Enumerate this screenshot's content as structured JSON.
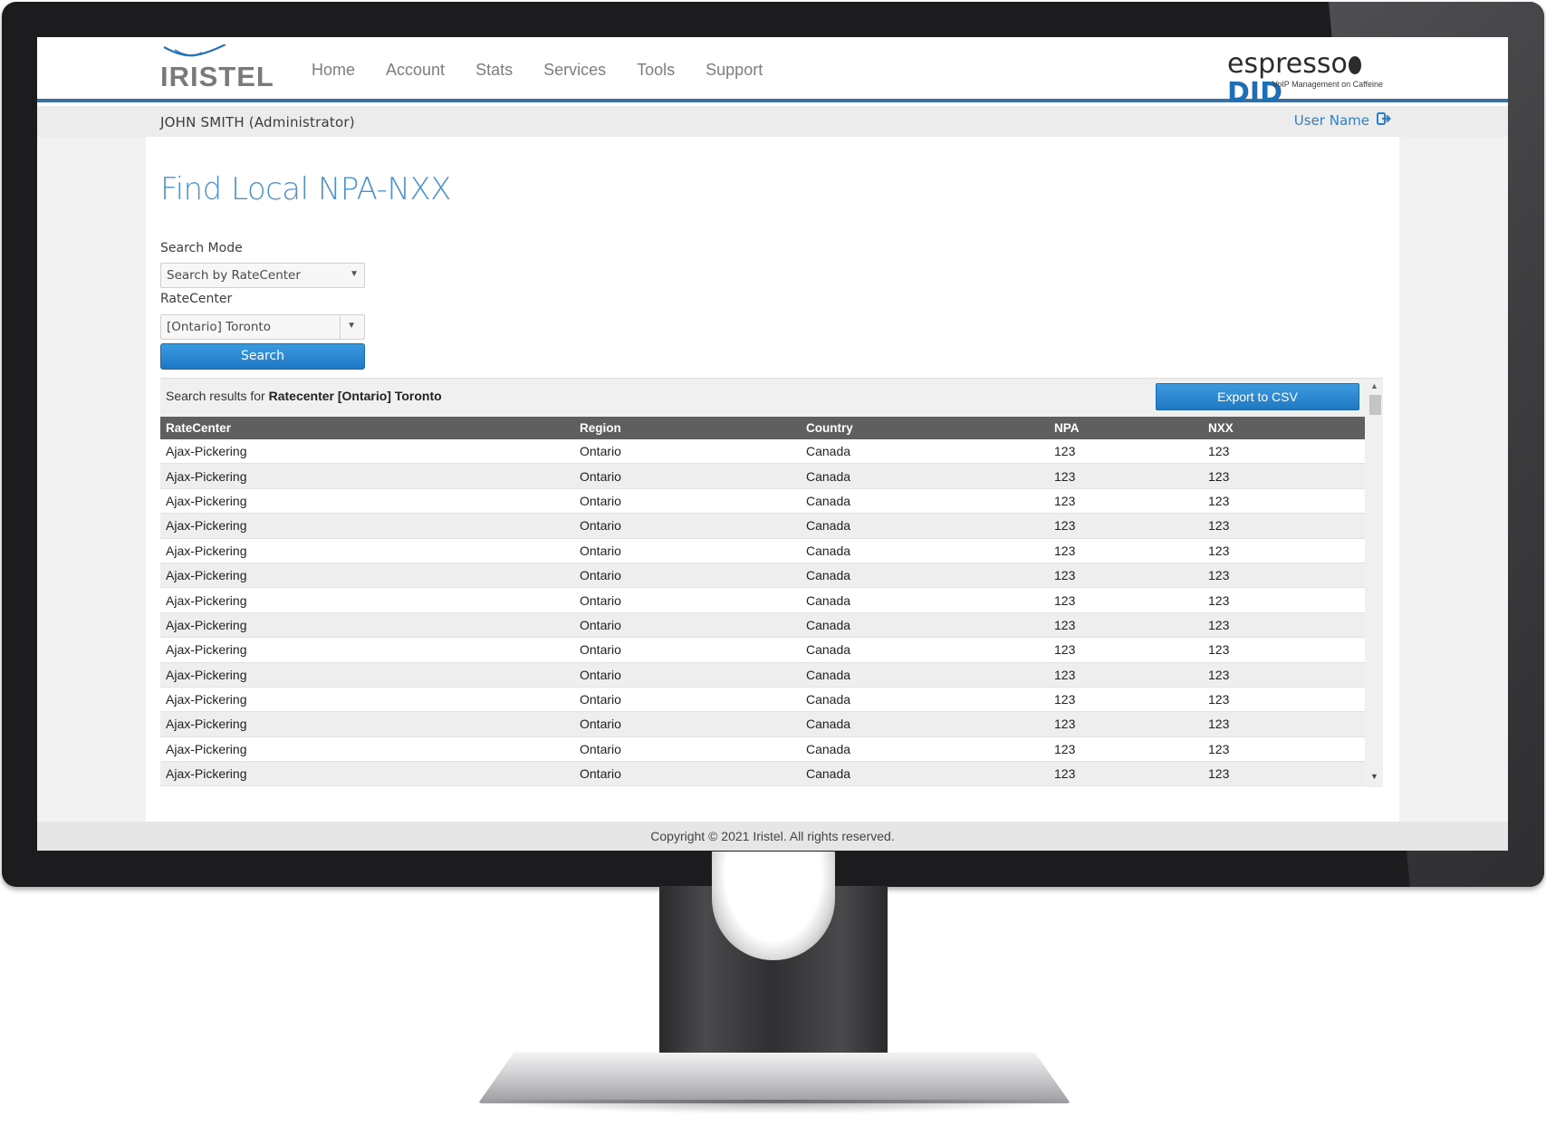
{
  "header": {
    "brand_left": "IRISTEL",
    "brand_right_prefix": "espresso",
    "brand_right_suffix": "DID",
    "brand_right_tagline": "VoIP Management on Caffeine",
    "nav": [
      "Home",
      "Account",
      "Stats",
      "Services",
      "Tools",
      "Support"
    ]
  },
  "userbar": {
    "current_user": "JOHN SMITH (Administrator)",
    "user_link": "User Name"
  },
  "page": {
    "title": "Find Local NPA-NXX",
    "search_mode_label": "Search Mode",
    "search_mode_value": "Search by RateCenter",
    "ratecenter_label": "RateCenter",
    "ratecenter_value": "[Ontario] Toronto",
    "search_button": "Search"
  },
  "results": {
    "caption_prefix": "Search results for",
    "caption_query": "Ratecenter [Ontario] Toronto",
    "export_button": "Export to CSV",
    "columns": [
      "RateCenter",
      "Region",
      "Country",
      "NPA",
      "NXX"
    ],
    "rows": [
      [
        "Ajax-Pickering",
        "Ontario",
        "Canada",
        "123",
        "123"
      ],
      [
        "Ajax-Pickering",
        "Ontario",
        "Canada",
        "123",
        "123"
      ],
      [
        "Ajax-Pickering",
        "Ontario",
        "Canada",
        "123",
        "123"
      ],
      [
        "Ajax-Pickering",
        "Ontario",
        "Canada",
        "123",
        "123"
      ],
      [
        "Ajax-Pickering",
        "Ontario",
        "Canada",
        "123",
        "123"
      ],
      [
        "Ajax-Pickering",
        "Ontario",
        "Canada",
        "123",
        "123"
      ],
      [
        "Ajax-Pickering",
        "Ontario",
        "Canada",
        "123",
        "123"
      ],
      [
        "Ajax-Pickering",
        "Ontario",
        "Canada",
        "123",
        "123"
      ],
      [
        "Ajax-Pickering",
        "Ontario",
        "Canada",
        "123",
        "123"
      ],
      [
        "Ajax-Pickering",
        "Ontario",
        "Canada",
        "123",
        "123"
      ],
      [
        "Ajax-Pickering",
        "Ontario",
        "Canada",
        "123",
        "123"
      ],
      [
        "Ajax-Pickering",
        "Ontario",
        "Canada",
        "123",
        "123"
      ],
      [
        "Ajax-Pickering",
        "Ontario",
        "Canada",
        "123",
        "123"
      ],
      [
        "Ajax-Pickering",
        "Ontario",
        "Canada",
        "123",
        "123"
      ]
    ]
  },
  "footer": {
    "copyright": "Copyright © 2021 Iristel. All rights reserved."
  },
  "icons": {
    "logout": "logout-icon",
    "dropdown": "chevron-down-icon",
    "scroll_up": "scroll-up-icon",
    "scroll_down": "scroll-down-icon"
  },
  "colors": {
    "accent_blue": "#1e78c4",
    "title_blue": "#4b93cf",
    "header_rule": "#3a6fa4",
    "grid_header": "#5f5f5f"
  }
}
